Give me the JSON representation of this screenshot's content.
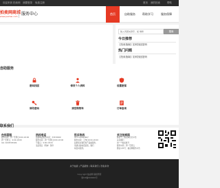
{
  "topbar": {
    "left": [
      "欢迎来到",
      "拍卖网",
      "我要登录",
      "免费注册"
    ],
    "right": [
      "首页",
      "我的拍卖",
      "帮助"
    ]
  },
  "header": {
    "logo_main": "拍卖网商城",
    "logo_sub": "www.paimai.com",
    "page_title": "服务中心",
    "nav": [
      "首页",
      "自助服务",
      "帮助学习",
      "服务保障"
    ]
  },
  "search": {
    "placeholder": "输入问题关键字，如 维修",
    "button_label": "搜索"
  },
  "today": {
    "title": "今日推荐",
    "links": [
      "【拍卖指南】如何找回密码"
    ]
  },
  "hot": {
    "title": "热门问题",
    "links": [
      "【拍卖指南】如何找回密码"
    ]
  },
  "self_service": {
    "title": "自助服务",
    "items": [
      {
        "label": "密码找回",
        "icon": "lock-icon"
      },
      {
        "label": "修改个人资料",
        "icon": "user-icon"
      },
      {
        "label": "设置密保",
        "icon": "shield-icon"
      },
      {
        "label": "修改密码",
        "icon": "key-icon"
      },
      {
        "label": "清空购物车",
        "icon": "trash-icon"
      },
      {
        "label": "订单查询",
        "icon": "order-icon"
      }
    ]
  },
  "contact": {
    "title": "联系我们",
    "cols": [
      {
        "title": "在线客服",
        "lines": [
          "服务时间：周一至周日9:00-18:00",
          "周一至周五：9:00-18:00",
          "QQ: 4008705999"
        ]
      },
      {
        "title": "热线电话",
        "lines": [
          "热线电话服务时间：33330999",
          "服务时间：周一至周日9:00-18:00",
          "节假日：9:00-18:00",
          "法定假日（周末）暂停"
        ]
      },
      {
        "title": "投诉热线",
        "lines": [
          "0571-69994667",
          "服务时间：工作日9:00-18:00",
          "如果您对我们的产品和服务，",
          "请通过此电话反馈，我们",
          "将及时处理。"
        ]
      }
    ],
    "wechat": {
      "title": "关注拍卖网",
      "lines": [
        "微信号：拍卖网官方平台",
        "关注我们",
        "用一个拍卖账号",
        "服务时间：周一至周五",
        "微信公众号：拍卖网服务平台"
      ]
    }
  },
  "footer": {
    "links": "关于拍卖 | 产品服务 | 联系我们 | 隐私条款",
    "lines": [
      "Copyright 拍卖网 版权所有",
      "浙ICP备000000号"
    ]
  },
  "colors": {
    "accent": "#e63a24",
    "footer_bg": "#222222",
    "topbar_bg": "#2b2b2b"
  }
}
